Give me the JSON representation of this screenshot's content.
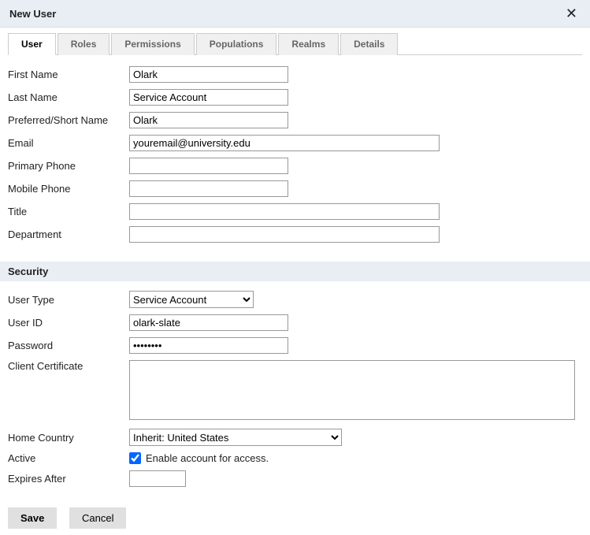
{
  "dialog": {
    "title": "New User"
  },
  "tabs": [
    "User",
    "Roles",
    "Permissions",
    "Populations",
    "Realms",
    "Details"
  ],
  "labels": {
    "first_name": "First Name",
    "last_name": "Last Name",
    "preferred": "Preferred/Short Name",
    "email": "Email",
    "primary_phone": "Primary Phone",
    "mobile_phone": "Mobile Phone",
    "title": "Title",
    "department": "Department",
    "user_type": "User Type",
    "user_id": "User ID",
    "password": "Password",
    "client_cert": "Client Certificate",
    "home_country": "Home Country",
    "active": "Active",
    "expires_after": "Expires After"
  },
  "values": {
    "first_name": "Olark",
    "last_name": "Service Account",
    "preferred": "Olark",
    "email": "youremail@university.edu",
    "primary_phone": "",
    "mobile_phone": "",
    "title": "",
    "department": "",
    "user_type": "Service Account",
    "user_id": "olark-slate",
    "password": "••••••••",
    "client_cert": "",
    "home_country": "Inherit: United States",
    "active_checked": true,
    "active_label": "Enable account for access.",
    "expires_after": ""
  },
  "sections": {
    "security": "Security"
  },
  "buttons": {
    "save": "Save",
    "cancel": "Cancel"
  }
}
